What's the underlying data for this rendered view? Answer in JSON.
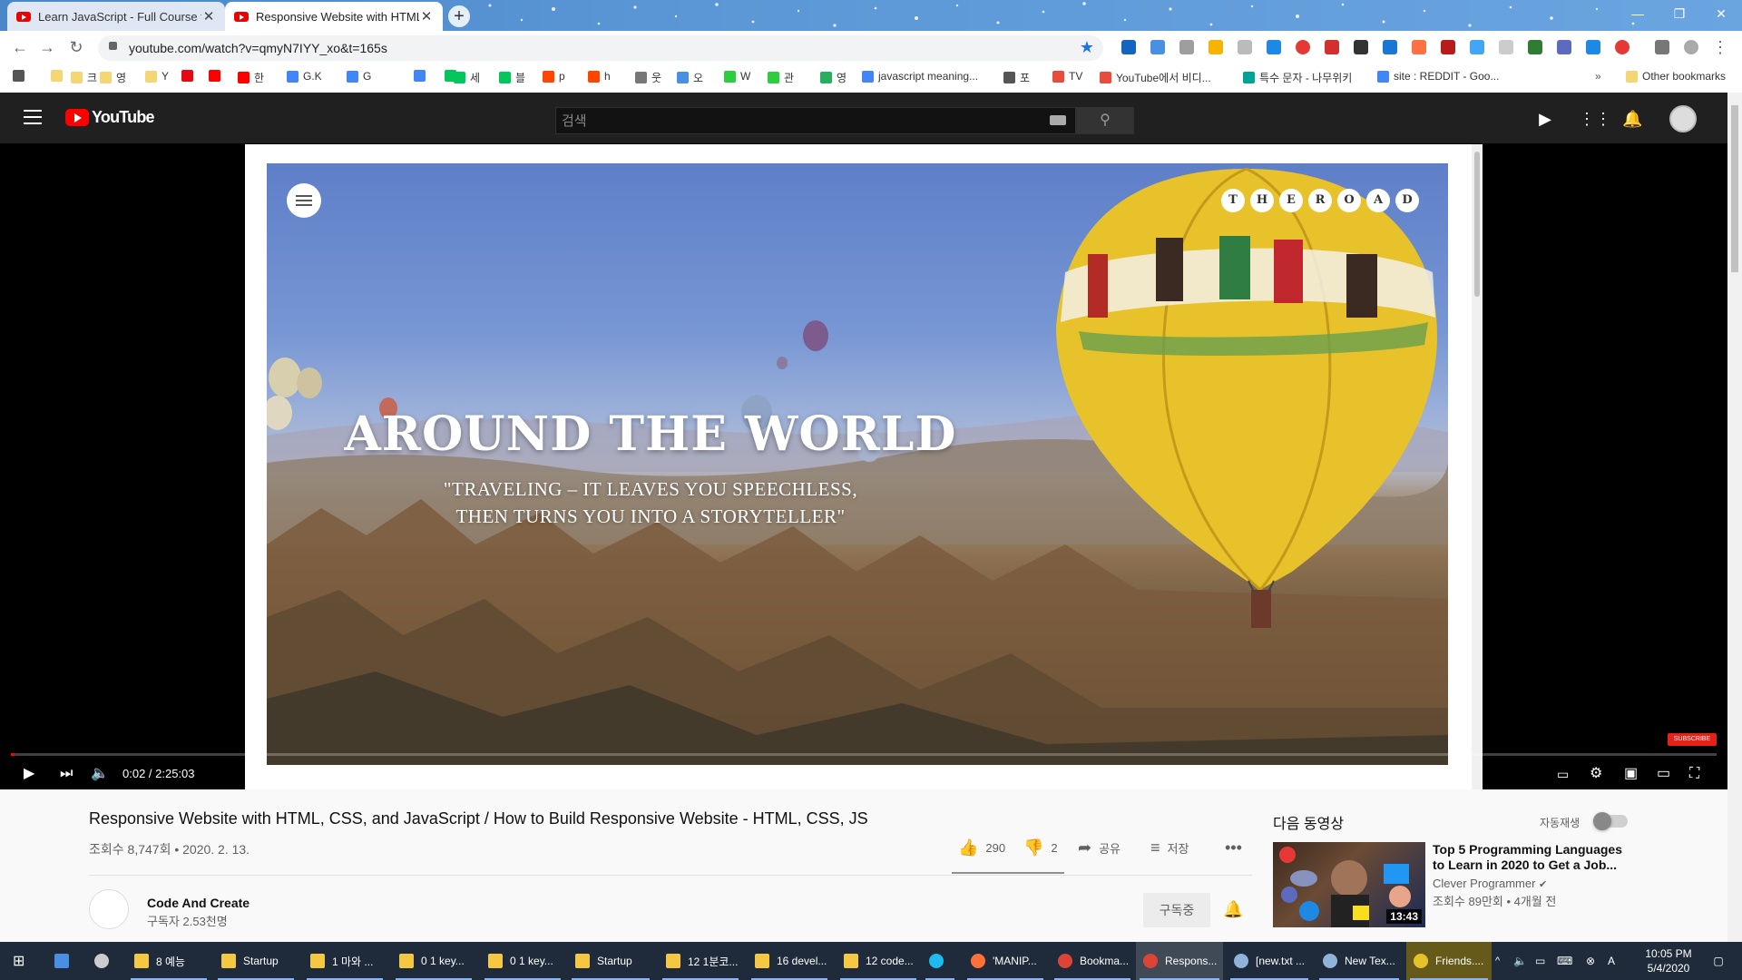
{
  "browser": {
    "tabs": [
      {
        "title": "Learn JavaScript - Full Course for",
        "active": false
      },
      {
        "title": "Responsive Website with HTML",
        "active": true
      }
    ],
    "url": "youtube.com/watch?v=qmyN7IYY_xo&t=165s",
    "bookmarks": [
      {
        "label": "",
        "icon": "star-icon",
        "color": "#555555"
      },
      {
        "label": "",
        "icon": "folder-icon",
        "color": "#f4d675"
      },
      {
        "label": "크",
        "icon": "folder-icon",
        "color": "#f4d675"
      },
      {
        "label": "영",
        "icon": "folder-icon",
        "color": "#f4d675"
      },
      {
        "label": "Y",
        "icon": "folder-icon",
        "color": "#f4d675"
      },
      {
        "label": "",
        "icon": "netflix-icon",
        "color": "#e50914"
      },
      {
        "label": "",
        "icon": "youtube-icon",
        "color": "#ff0000"
      },
      {
        "label": "한",
        "icon": "youtube-icon",
        "color": "#ff0000"
      },
      {
        "label": "G.K",
        "icon": "google-icon",
        "color": "#4285f4"
      },
      {
        "label": "G",
        "icon": "google-icon",
        "color": "#4285f4"
      },
      {
        "label": "",
        "icon": "naver-icon",
        "color": "#03c75a"
      },
      {
        "label": "",
        "icon": "docs-icon",
        "color": "#4285f4"
      },
      {
        "label": "세",
        "icon": "naver-icon",
        "color": "#03c75a"
      },
      {
        "label": "블",
        "icon": "blog-icon",
        "color": "#03c75a"
      },
      {
        "label": "p",
        "icon": "reddit-icon",
        "color": "#ff4500"
      },
      {
        "label": "h",
        "icon": "reddit-icon",
        "color": "#ff4500"
      },
      {
        "label": "웃",
        "icon": "bird-icon",
        "color": "#777777"
      },
      {
        "label": "오",
        "icon": "people-icon",
        "color": "#4a90e2"
      },
      {
        "label": "W",
        "icon": "leaf-icon",
        "color": "#2ecc40"
      },
      {
        "label": "관",
        "icon": "leaf-icon",
        "color": "#2ecc40"
      },
      {
        "label": "영",
        "icon": "square-icon",
        "color": "#27ae60"
      },
      {
        "label": "javascript meaning...",
        "icon": "google-icon",
        "color": "#4285f4"
      },
      {
        "label": "포",
        "icon": "globe-icon",
        "color": "#555555"
      },
      {
        "label": "TV",
        "icon": "tomato-icon",
        "color": "#e74c3c"
      },
      {
        "label": "YouTube에서 비디...",
        "icon": "download-icon",
        "color": "#e74c3c"
      },
      {
        "label": "특수 문자 - 나무위키",
        "icon": "namu-icon",
        "color": "#00a495"
      },
      {
        "label": "site : REDDIT - Goo...",
        "icon": "google-icon",
        "color": "#4285f4"
      }
    ],
    "other_bookmarks": "Other bookmarks"
  },
  "youtube": {
    "logo_text": "YouTube",
    "search_placeholder": "검색"
  },
  "video": {
    "hero_title": "AROUND THE WORLD",
    "hero_quote_line1": "\"TRAVELING – IT LEAVES YOU SPEECHLESS,",
    "hero_quote_line2": "THEN TURNS YOU INTO A STORYTELLER\"",
    "brand_letters": [
      "T",
      "H",
      "E",
      "R",
      "O",
      "A",
      "D"
    ],
    "time": "0:02 / 2:25:03",
    "progress_fraction": 0.0002,
    "subscribe_watermark": "SUBSCRIBE"
  },
  "info": {
    "title": "Responsive Website with HTML, CSS, and JavaScript / How to Build Responsive Website - HTML, CSS, JS",
    "views": "조회수 8,747회 • 2020. 2. 13.",
    "likes": "290",
    "dislikes": "2",
    "share": "공유",
    "save": "저장",
    "channel_name": "Code And Create",
    "subscribers": "구독자 2.53천명",
    "subscribed_label": "구독중"
  },
  "sidebar": {
    "up_next": "다음 동영상",
    "autoplay": "자동재생",
    "autoplay_on": false,
    "recommended": {
      "title": "Top 5 Programming Languages to Learn in 2020 to Get a Job...",
      "channel": "Clever Programmer",
      "meta": "조회수 89만회 • 4개월 전",
      "duration": "13:43"
    }
  },
  "taskbar": {
    "items": [
      {
        "label": "8 예능",
        "icon": "folder-icon",
        "color": "#f4c842"
      },
      {
        "label": "Startup",
        "icon": "folder-icon",
        "color": "#f4c842"
      },
      {
        "label": "1 마와 ...",
        "icon": "folder-icon",
        "color": "#f4c842"
      },
      {
        "label": "0 1 key...",
        "icon": "folder-icon",
        "color": "#f4c842"
      },
      {
        "label": "0 1 key...",
        "icon": "folder-icon",
        "color": "#f4c842"
      },
      {
        "label": "Startup",
        "icon": "folder-icon",
        "color": "#f4c842"
      },
      {
        "label": "12 1분코...",
        "icon": "folder-icon",
        "color": "#f4c842"
      },
      {
        "label": "16 devel...",
        "icon": "folder-icon",
        "color": "#f4c842"
      },
      {
        "label": "12 code...",
        "icon": "folder-icon",
        "color": "#f4c842"
      },
      {
        "label": "",
        "icon": "ie-icon",
        "color": "#1ebbee"
      },
      {
        "label": "'MANIP...",
        "icon": "firefox-icon",
        "color": "#ff7139"
      },
      {
        "label": "Bookma...",
        "icon": "chrome-icon",
        "color": "#db4437"
      },
      {
        "label": "Respons...",
        "icon": "chrome-icon",
        "color": "#db4437"
      },
      {
        "label": "[new.txt ...",
        "icon": "notepad-icon",
        "color": "#8fb3d9"
      },
      {
        "label": "New Tex...",
        "icon": "notepad-icon",
        "color": "#8fb3d9"
      },
      {
        "label": "Friends....",
        "icon": "media-icon",
        "color": "#e6c229"
      }
    ],
    "time": "10:05 PM",
    "date": "5/4/2020"
  }
}
